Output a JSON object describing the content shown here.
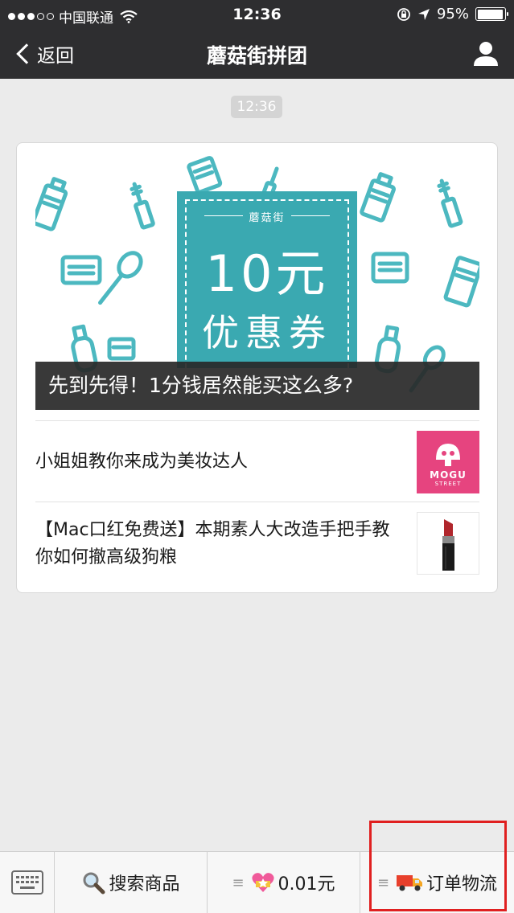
{
  "status_bar": {
    "carrier": "中国联通",
    "time": "12:36",
    "battery": "95%",
    "battery_level": 0.95
  },
  "nav": {
    "back_label": "返回",
    "title": "蘑菇街拼团"
  },
  "chat": {
    "timestamp": "12:36"
  },
  "news_card": {
    "hero": {
      "coupon_brand": "蘑菇街",
      "coupon_amount": "10元",
      "coupon_kind": "优惠券",
      "caption": "先到先得！1分钱居然能买这么多?"
    },
    "articles": [
      {
        "title": "小姐姐教你来成为美妆达人",
        "thumb_brand": "MOGU",
        "thumb_sub": "STREET"
      },
      {
        "title": "【Mac口红免费送】本期素人大改造手把手教你如何撤高级狗粮"
      }
    ]
  },
  "bottom_menu": {
    "items": [
      {
        "label": "搜索商品",
        "icon": "magnifier-icon"
      },
      {
        "label": "0.01元",
        "icon": "sparkling-heart-icon"
      },
      {
        "label": "订单物流",
        "icon": "delivery-truck-icon"
      }
    ]
  },
  "colors": {
    "nav_bg": "#2e2e30",
    "page_bg": "#ebebeb",
    "coupon_teal": "#3aa9b1",
    "icon_teal": "#4cb8c0",
    "mogu_pink": "#e6447f",
    "highlight_red": "#e02020"
  }
}
